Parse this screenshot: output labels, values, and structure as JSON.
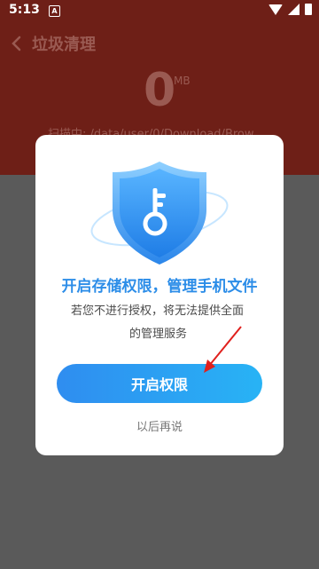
{
  "status_bar": {
    "time": "5:13",
    "notification_letter": "A",
    "icons": [
      "notification-a-icon",
      "wifi-icon",
      "signal-icon",
      "battery-icon"
    ]
  },
  "header": {
    "title": "垃圾清理",
    "back_icon": "chevron-left-icon"
  },
  "scan": {
    "size_value": "0",
    "size_unit": "MB",
    "status_text": "扫描中: /data/user/0/Download/Brow"
  },
  "dialog": {
    "icon": "shield-key-icon",
    "title": "开启存储权限，管理手机文件",
    "description_line1": "若您不进行授权，将无法提供全面",
    "description_line2": "的管理服务",
    "primary_button_label": "开启权限",
    "secondary_link_label": "以后再说"
  },
  "colors": {
    "accent_blue": "#2c8de8",
    "button_gradient_start": "#2f8df0",
    "button_gradient_end": "#28b3f5",
    "annotation_arrow": "#e0201d",
    "app_header_bg": "#6e1f17"
  }
}
